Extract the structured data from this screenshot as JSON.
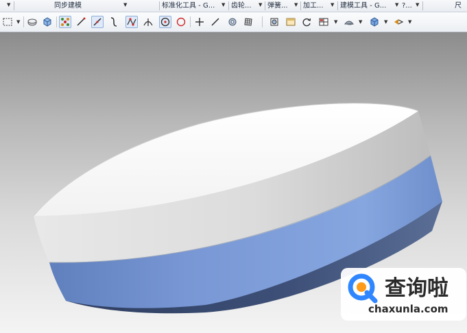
{
  "menubar": {
    "groups": [
      {
        "label": "同步建模"
      },
      {
        "label": "标准化工具 - G..."
      },
      {
        "label": "齿轮..."
      },
      {
        "label": "弹簧..."
      },
      {
        "label": "加工..."
      },
      {
        "label": "建模工具 - G..."
      },
      {
        "label": "?..."
      },
      {
        "label": "尺"
      }
    ],
    "dropdown_glyph": "▼"
  },
  "toolbar": {
    "icons": [
      "select-box-icon",
      "shape-solid-icon",
      "cube-icon",
      "snap-points-icon",
      "line-icon",
      "diagonal-line-icon",
      "curve-icon",
      "point-curve-icon",
      "perpendicular-icon",
      "circle-center-icon",
      "circle-icon",
      "crosshair-icon",
      "slash-icon",
      "gear-view-icon",
      "grid-icon",
      "fit-view-icon",
      "window-icon",
      "rotate-icon",
      "layout-icon",
      "shade-icon",
      "render-cube-icon",
      "view-direction-icon"
    ]
  },
  "colors": {
    "top_face": "#ffffff",
    "upper_band": "#e2e2e2",
    "lower_band": "#7fa0d8",
    "bottom_shadow": "#3d4f75",
    "accent_blue": "#2f86ff"
  },
  "watermark": {
    "title": "查询啦",
    "url": "chaxunla.com"
  }
}
